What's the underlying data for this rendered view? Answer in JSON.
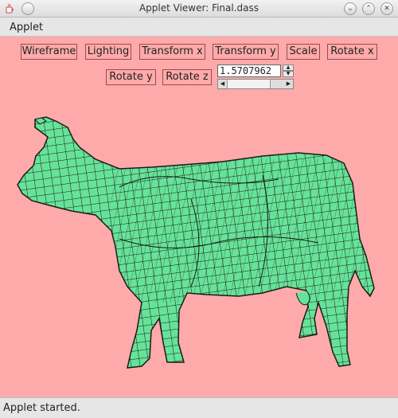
{
  "window": {
    "title": "Applet Viewer: Final.dass"
  },
  "menu": {
    "items": [
      "Applet"
    ]
  },
  "toolbar": {
    "wireframe": "Wireframe",
    "lighting": "Lighting",
    "transform_x": "Transform x",
    "transform_y": "Transform y",
    "scale": "Scale",
    "rotate_x": "Rotate x",
    "rotate_y": "Rotate y",
    "rotate_z": "Rotate z"
  },
  "spinner": {
    "value": "1.5707962"
  },
  "status": {
    "text": "Applet started."
  },
  "colors": {
    "background": "#ffaaaa",
    "mesh_fill": "#66e399",
    "mesh_line": "#1a1a1a"
  },
  "icons": [
    "java-cup-icon",
    "minimize-icon",
    "maximize-icon",
    "close-icon"
  ]
}
